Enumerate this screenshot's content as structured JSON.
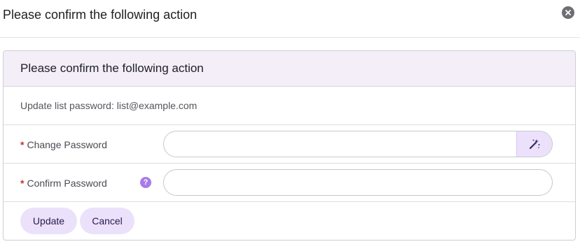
{
  "dialog": {
    "title": "Please confirm the following action"
  },
  "panel": {
    "title": "Please confirm the following action",
    "description": "Update list password: list@example.com",
    "fields": {
      "change_password": {
        "required_mark": "*",
        "label": "Change Password",
        "value": "",
        "placeholder": ""
      },
      "confirm_password": {
        "required_mark": "*",
        "label": "Confirm Password",
        "value": "",
        "placeholder": "",
        "help_glyph": "?"
      }
    },
    "actions": {
      "update_label": "Update",
      "cancel_label": "Cancel"
    }
  },
  "icons": {
    "close": "close-icon",
    "generate": "magic-wand-icon",
    "help": "help-icon"
  },
  "colors": {
    "accent_light": "#ece1fb",
    "panel_header_bg": "#f3eef7",
    "help_icon": "#a87be8",
    "required": "#c0392b"
  }
}
